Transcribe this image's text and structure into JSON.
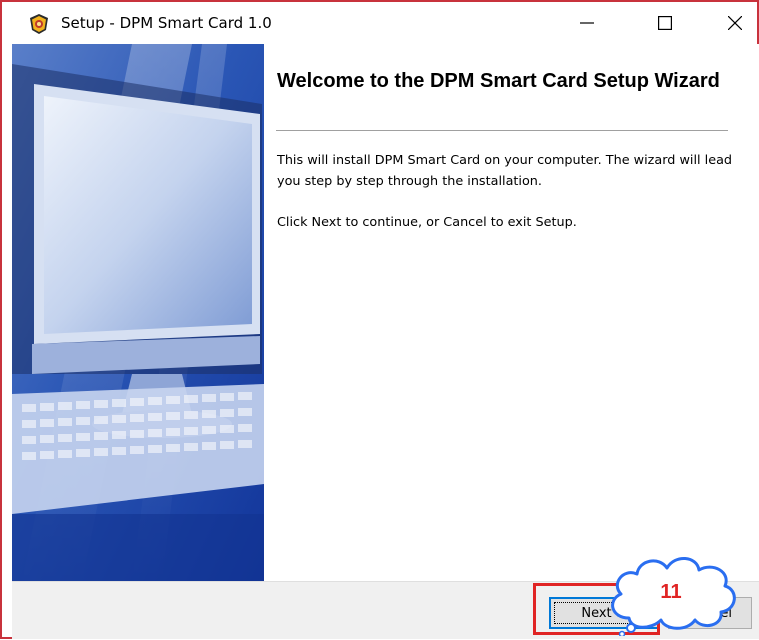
{
  "window": {
    "title": "Setup - DPM Smart Card 1.0",
    "minimize_icon": "minimize-icon",
    "maximize_icon": "maximize-icon",
    "close_icon": "close-icon"
  },
  "banner": {
    "image": "computer-monitor-keyboard-illustration"
  },
  "content": {
    "heading": "Welcome to the DPM Smart Card Setup Wizard",
    "paragraph1": "This will install DPM Smart Card on your computer. The wizard will lead you step by step through the installation.",
    "paragraph2": "Click Next to continue, or Cancel to exit Setup."
  },
  "footer": {
    "next_label": "Next >",
    "cancel_label": "Cancel"
  },
  "annotation": {
    "step_number": "11",
    "highlight_color": "#e02424",
    "callout_icon": "cloud-callout"
  },
  "colors": {
    "window_border": "#c8323c",
    "banner_blue": "#1f4fb0",
    "footer_bg": "#f0f0f0"
  }
}
